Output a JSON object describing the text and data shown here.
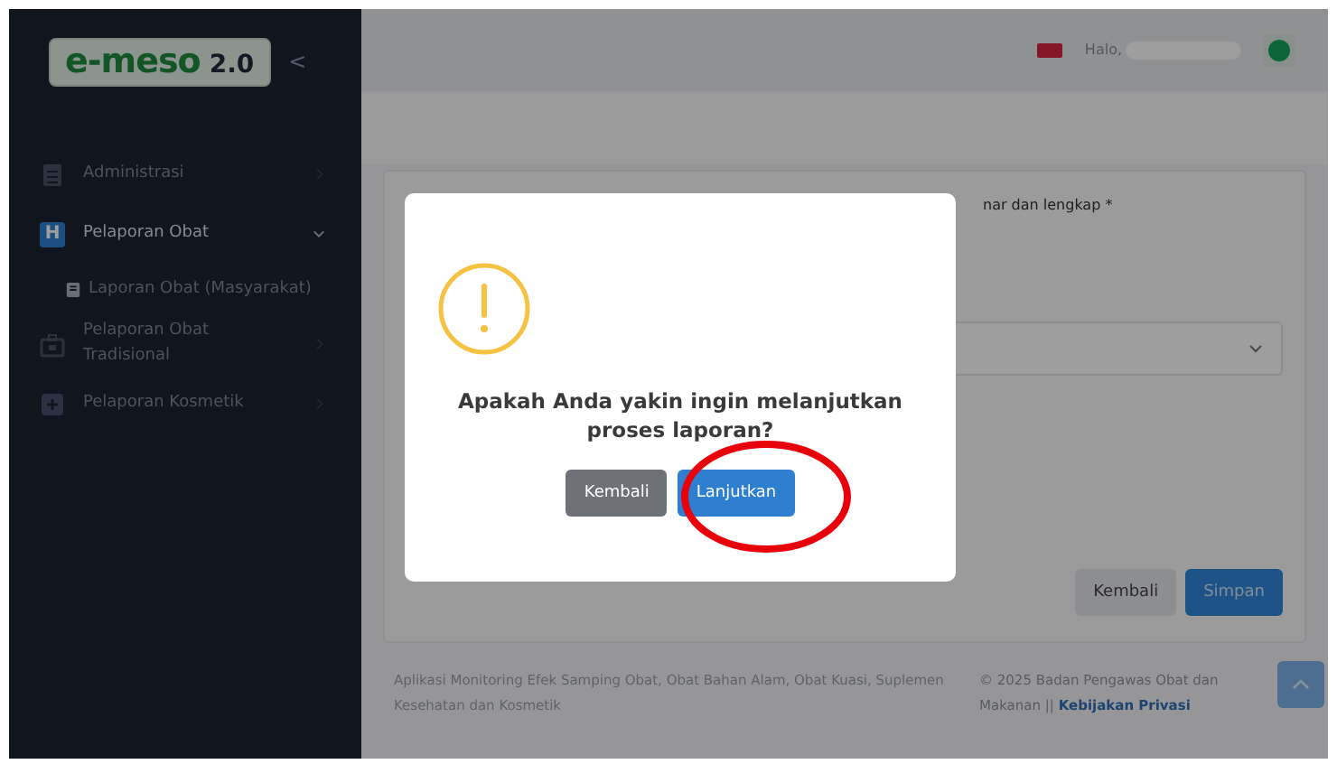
{
  "logo": {
    "brand": "e-meso",
    "version": "2.0",
    "collapse_glyph": "<"
  },
  "sidebar": {
    "items": [
      {
        "label": "Administrasi",
        "kind": "doc",
        "expanded": false,
        "selected": false
      },
      {
        "label": "Pelaporan Obat",
        "kind": "letter",
        "icon_text": "H",
        "expanded": true,
        "selected": true,
        "children": [
          {
            "label": "Laporan Obat (Masyarakat)",
            "kind": "book",
            "selected": false
          }
        ]
      },
      {
        "label": "Pelaporan Obat Tradisional",
        "kind": "case",
        "expanded": false,
        "selected": false
      },
      {
        "label": "Pelaporan Kosmetik",
        "kind": "plus",
        "expanded": false,
        "selected": false
      }
    ]
  },
  "topbar": {
    "greeting": "Halo,"
  },
  "form": {
    "label": "nar dan lengkap *",
    "buttons": [
      {
        "label": "Kembali",
        "kind": "secondary"
      },
      {
        "label": "Simpan",
        "kind": "primary"
      }
    ]
  },
  "footer": {
    "left": "Aplikasi Monitoring Efek Samping Obat, Obat Bahan Alam, Obat Kuasi, Suplemen Kesehatan dan Kosmetik",
    "right": "© 2025 Badan Pengawas Obat dan Makanan ||",
    "link": "Kebijakan Privasi"
  },
  "dialog": {
    "message": "Apakah Anda yakin ingin melanjutkan proses laporan?",
    "buttons": [
      {
        "label": "Kembali",
        "kind": "cancel"
      },
      {
        "label": "Lanjutkan",
        "kind": "confirm",
        "highlighted": true
      }
    ]
  }
}
